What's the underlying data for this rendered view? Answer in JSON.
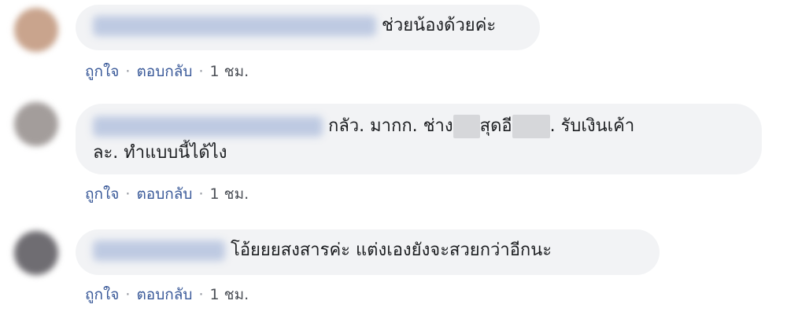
{
  "comments": [
    {
      "text_parts": [
        "ช่วยน้องด้วยค่ะ"
      ],
      "actions": {
        "like": "ถูกใจ",
        "reply": "ตอบกลับ",
        "time": "1 ชม."
      },
      "avatar_color": "#c9a48d"
    },
    {
      "text_parts": [
        "กลัว. มากก. ช่าง",
        "สุดอี",
        ". รับเงินเค้า",
        "ละ. ทำแบบนี้ได้ไง"
      ],
      "actions": {
        "like": "ถูกใจ",
        "reply": "ตอบกลับ",
        "time": "1 ชม."
      },
      "avatar_color": "#a39d9b"
    },
    {
      "text_parts": [
        "โอ้ยยยสงสารค่ะ แต่งเองยังจะสวยกว่าอีกนะ"
      ],
      "actions": {
        "like": "ถูกใจ",
        "reply": "ตอบกลับ",
        "time": "1 ชม."
      },
      "avatar_color": "#6f6d72"
    }
  ],
  "separator": "·",
  "colors": {
    "bubble": "#f2f3f5",
    "link": "#385898",
    "text": "#1c1e21"
  }
}
